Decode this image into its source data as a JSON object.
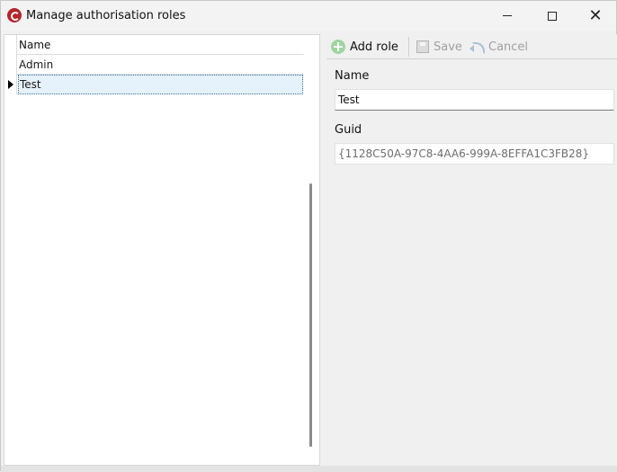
{
  "window": {
    "title": "Manage authorisation roles"
  },
  "grid": {
    "header": "Name",
    "rows": [
      "Admin",
      "Test"
    ]
  },
  "toolbar": {
    "add_label": "Add role",
    "save_label": "Save",
    "cancel_label": "Cancel"
  },
  "form": {
    "name_label": "Name",
    "name_value": "Test",
    "guid_label": "Guid",
    "guid_value": "{1128C50A-97C8-4AA6-999A-8EFFA1C3FB28}"
  }
}
